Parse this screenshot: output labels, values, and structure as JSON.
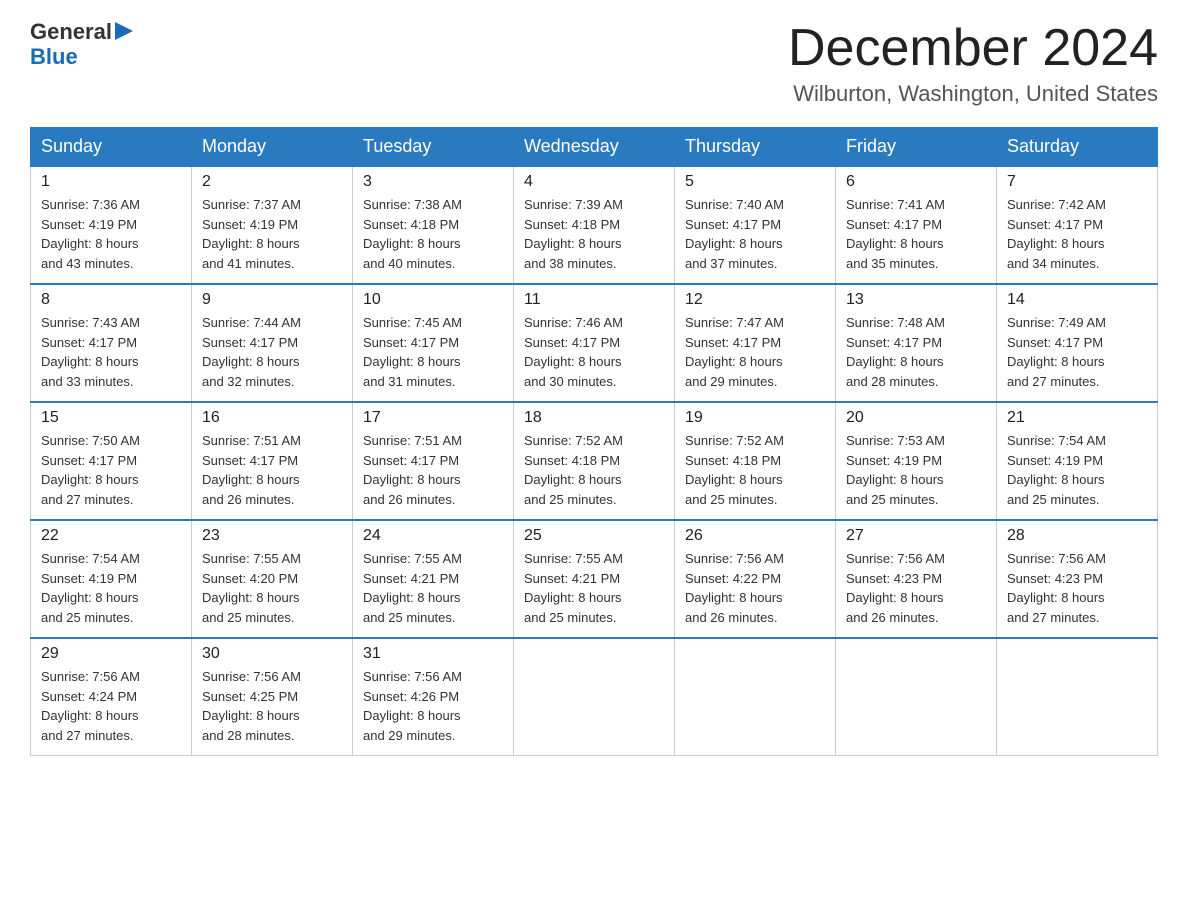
{
  "header": {
    "logo_general": "General",
    "logo_blue": "Blue",
    "title": "December 2024",
    "location": "Wilburton, Washington, United States"
  },
  "days_of_week": [
    "Sunday",
    "Monday",
    "Tuesday",
    "Wednesday",
    "Thursday",
    "Friday",
    "Saturday"
  ],
  "weeks": [
    [
      {
        "day": "1",
        "sunrise": "7:36 AM",
        "sunset": "4:19 PM",
        "daylight": "8 hours and 43 minutes."
      },
      {
        "day": "2",
        "sunrise": "7:37 AM",
        "sunset": "4:19 PM",
        "daylight": "8 hours and 41 minutes."
      },
      {
        "day": "3",
        "sunrise": "7:38 AM",
        "sunset": "4:18 PM",
        "daylight": "8 hours and 40 minutes."
      },
      {
        "day": "4",
        "sunrise": "7:39 AM",
        "sunset": "4:18 PM",
        "daylight": "8 hours and 38 minutes."
      },
      {
        "day": "5",
        "sunrise": "7:40 AM",
        "sunset": "4:17 PM",
        "daylight": "8 hours and 37 minutes."
      },
      {
        "day": "6",
        "sunrise": "7:41 AM",
        "sunset": "4:17 PM",
        "daylight": "8 hours and 35 minutes."
      },
      {
        "day": "7",
        "sunrise": "7:42 AM",
        "sunset": "4:17 PM",
        "daylight": "8 hours and 34 minutes."
      }
    ],
    [
      {
        "day": "8",
        "sunrise": "7:43 AM",
        "sunset": "4:17 PM",
        "daylight": "8 hours and 33 minutes."
      },
      {
        "day": "9",
        "sunrise": "7:44 AM",
        "sunset": "4:17 PM",
        "daylight": "8 hours and 32 minutes."
      },
      {
        "day": "10",
        "sunrise": "7:45 AM",
        "sunset": "4:17 PM",
        "daylight": "8 hours and 31 minutes."
      },
      {
        "day": "11",
        "sunrise": "7:46 AM",
        "sunset": "4:17 PM",
        "daylight": "8 hours and 30 minutes."
      },
      {
        "day": "12",
        "sunrise": "7:47 AM",
        "sunset": "4:17 PM",
        "daylight": "8 hours and 29 minutes."
      },
      {
        "day": "13",
        "sunrise": "7:48 AM",
        "sunset": "4:17 PM",
        "daylight": "8 hours and 28 minutes."
      },
      {
        "day": "14",
        "sunrise": "7:49 AM",
        "sunset": "4:17 PM",
        "daylight": "8 hours and 27 minutes."
      }
    ],
    [
      {
        "day": "15",
        "sunrise": "7:50 AM",
        "sunset": "4:17 PM",
        "daylight": "8 hours and 27 minutes."
      },
      {
        "day": "16",
        "sunrise": "7:51 AM",
        "sunset": "4:17 PM",
        "daylight": "8 hours and 26 minutes."
      },
      {
        "day": "17",
        "sunrise": "7:51 AM",
        "sunset": "4:17 PM",
        "daylight": "8 hours and 26 minutes."
      },
      {
        "day": "18",
        "sunrise": "7:52 AM",
        "sunset": "4:18 PM",
        "daylight": "8 hours and 25 minutes."
      },
      {
        "day": "19",
        "sunrise": "7:52 AM",
        "sunset": "4:18 PM",
        "daylight": "8 hours and 25 minutes."
      },
      {
        "day": "20",
        "sunrise": "7:53 AM",
        "sunset": "4:19 PM",
        "daylight": "8 hours and 25 minutes."
      },
      {
        "day": "21",
        "sunrise": "7:54 AM",
        "sunset": "4:19 PM",
        "daylight": "8 hours and 25 minutes."
      }
    ],
    [
      {
        "day": "22",
        "sunrise": "7:54 AM",
        "sunset": "4:19 PM",
        "daylight": "8 hours and 25 minutes."
      },
      {
        "day": "23",
        "sunrise": "7:55 AM",
        "sunset": "4:20 PM",
        "daylight": "8 hours and 25 minutes."
      },
      {
        "day": "24",
        "sunrise": "7:55 AM",
        "sunset": "4:21 PM",
        "daylight": "8 hours and 25 minutes."
      },
      {
        "day": "25",
        "sunrise": "7:55 AM",
        "sunset": "4:21 PM",
        "daylight": "8 hours and 25 minutes."
      },
      {
        "day": "26",
        "sunrise": "7:56 AM",
        "sunset": "4:22 PM",
        "daylight": "8 hours and 26 minutes."
      },
      {
        "day": "27",
        "sunrise": "7:56 AM",
        "sunset": "4:23 PM",
        "daylight": "8 hours and 26 minutes."
      },
      {
        "day": "28",
        "sunrise": "7:56 AM",
        "sunset": "4:23 PM",
        "daylight": "8 hours and 27 minutes."
      }
    ],
    [
      {
        "day": "29",
        "sunrise": "7:56 AM",
        "sunset": "4:24 PM",
        "daylight": "8 hours and 27 minutes."
      },
      {
        "day": "30",
        "sunrise": "7:56 AM",
        "sunset": "4:25 PM",
        "daylight": "8 hours and 28 minutes."
      },
      {
        "day": "31",
        "sunrise": "7:56 AM",
        "sunset": "4:26 PM",
        "daylight": "8 hours and 29 minutes."
      },
      null,
      null,
      null,
      null
    ]
  ],
  "labels": {
    "sunrise": "Sunrise:",
    "sunset": "Sunset:",
    "daylight": "Daylight:"
  }
}
